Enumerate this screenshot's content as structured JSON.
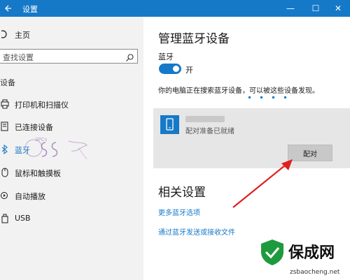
{
  "window": {
    "title": "设置",
    "back_icon": "back-arrow-icon",
    "minimize": "—",
    "maximize": "☐",
    "close": "✕"
  },
  "sidebar": {
    "home_label": "主页",
    "search_placeholder": "查找设置",
    "section_label": "设备",
    "items": [
      {
        "label": "打印机和扫描仪",
        "icon": "printer-icon",
        "active": false
      },
      {
        "label": "已连接设备",
        "icon": "connected-devices-icon",
        "active": false
      },
      {
        "label": "蓝牙",
        "icon": "bluetooth-icon",
        "active": true
      },
      {
        "label": "鼠标和触摸板",
        "icon": "mouse-icon",
        "active": false
      },
      {
        "label": "自动播放",
        "icon": "autoplay-icon",
        "active": false
      },
      {
        "label": "USB",
        "icon": "usb-icon",
        "active": false
      }
    ],
    "watermark_text": "3PCs"
  },
  "main": {
    "title": "管理蓝牙设备",
    "bluetooth_label": "蓝牙",
    "toggle_state": "开",
    "scan_text": "你的电脑正在搜索蓝牙设备，可以被这些设备发现。",
    "device": {
      "status": "配对准备已就绪",
      "pair_button": "配对"
    },
    "related_title": "相关设置",
    "links": [
      "更多蓝牙选项",
      "通过蓝牙发送或接收文件"
    ]
  },
  "watermark": {
    "brand": "保成网",
    "url": "zsbaocheng.net"
  },
  "colors": {
    "accent": "#1679c8",
    "sidebar_bg": "#f2f2f2",
    "card_bg": "#e6e6e6",
    "arrow": "#e02020",
    "logo_green": "#1e9a3e"
  }
}
